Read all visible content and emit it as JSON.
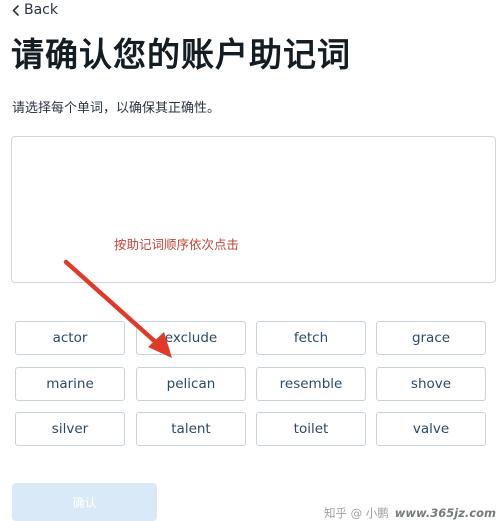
{
  "nav": {
    "back_label": "Back"
  },
  "header": {
    "title": "请确认您的账户助记词",
    "subtitle": "请选择每个单词，以确保其正确性。"
  },
  "phrase_box": {
    "hint": "按助记词顺序依次点击"
  },
  "words": [
    "actor",
    "exclude",
    "fetch",
    "grace",
    "marine",
    "pelican",
    "resemble",
    "shove",
    "silver",
    "talent",
    "toilet",
    "valve"
  ],
  "confirm_button": {
    "label": "确认"
  },
  "watermark": {
    "prefix": "知乎 @ 小鹏",
    "site": "www.365jz.com"
  },
  "colors": {
    "hint": "#c2453a",
    "arrow": "#e03a2a",
    "word_text": "#2b4a66",
    "confirm_bg": "#d9e9f8"
  }
}
